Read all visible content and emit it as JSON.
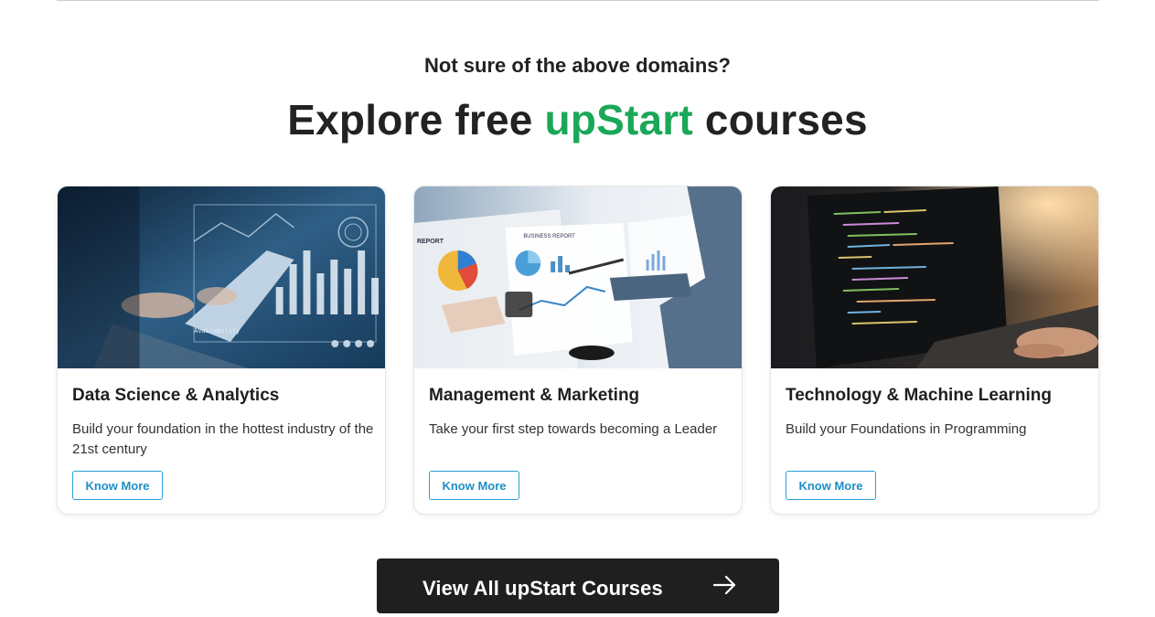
{
  "section": {
    "subheading": "Not sure of the above domains?",
    "heading_prefix": "Explore free ",
    "heading_accent": "upStart",
    "heading_suffix": " courses",
    "accent_color": "#1aa858"
  },
  "cards": [
    {
      "title": "Data Science & Analytics",
      "description": "Build your foundation in the hottest industry of the 21st century",
      "button_label": "Know More",
      "image_icon": "data-analytics-image"
    },
    {
      "title": "Management & Marketing",
      "description": "Take your first step towards becoming a Leader",
      "button_label": "Know More",
      "image_icon": "business-report-image"
    },
    {
      "title": "Technology & Machine Learning",
      "description": "Build your Foundations in Programming",
      "button_label": "Know More",
      "image_icon": "laptop-code-image"
    }
  ],
  "cta": {
    "label": "View All upStart Courses",
    "icon": "arrow-right-icon",
    "background": "#1f1f1f"
  },
  "image_text": {
    "report": "REPORT",
    "business_report": "BUSINESS REPORT",
    "availability": "Availability"
  }
}
